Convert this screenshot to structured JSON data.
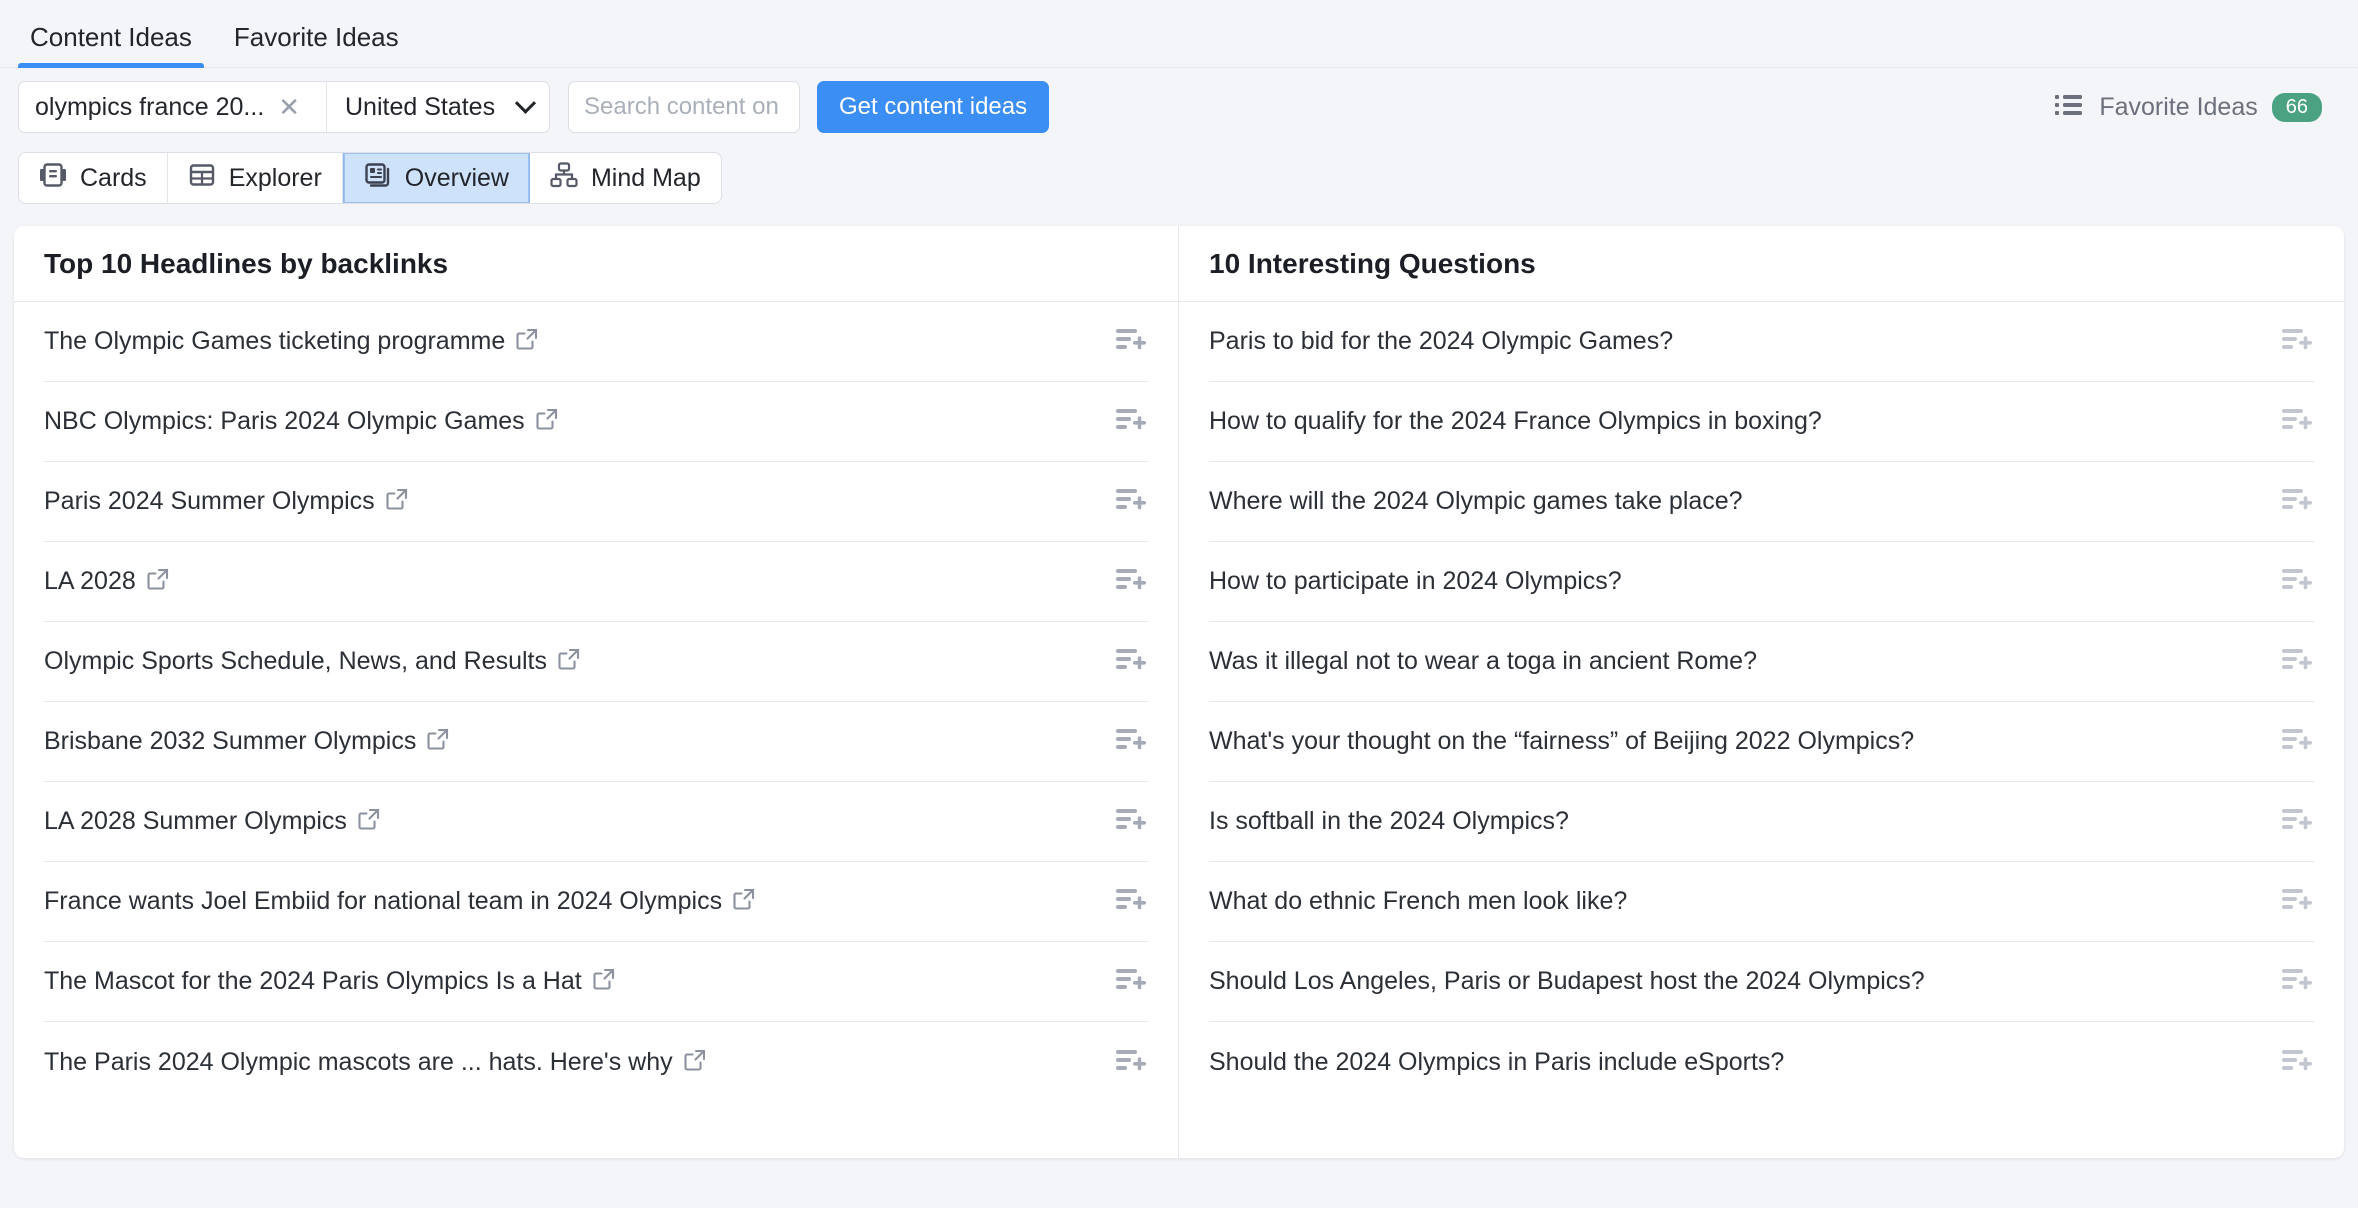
{
  "tabs": [
    {
      "label": "Content Ideas",
      "active": true
    },
    {
      "label": "Favorite Ideas",
      "active": false
    }
  ],
  "search": {
    "keyword_chip": "olympics france 20...",
    "chip_close_icon": "close-icon",
    "country": "United States",
    "country_caret_icon": "chevron-down-icon",
    "domain_placeholder": "Search content on domain",
    "domain_value": "",
    "cta_label": "Get content ideas",
    "cta_color": "#3b8ef3"
  },
  "favorites": {
    "icon": "list-icon",
    "label": "Favorite Ideas",
    "count": "66",
    "badge_color": "#4aa283"
  },
  "views": [
    {
      "label": "Cards",
      "icon": "cards-icon",
      "selected": false
    },
    {
      "label": "Explorer",
      "icon": "table-icon",
      "selected": false
    },
    {
      "label": "Overview",
      "icon": "overview-icon",
      "selected": true
    },
    {
      "label": "Mind Map",
      "icon": "mindmap-icon",
      "selected": false
    }
  ],
  "panels": {
    "headlines": {
      "title": "Top 10 Headlines by backlinks",
      "row_action_icon": "add-to-list-icon",
      "link_icon": "external-link-icon",
      "items": [
        "The Olympic Games ticketing programme",
        "NBC Olympics: Paris 2024 Olympic Games",
        "Paris 2024 Summer Olympics",
        "LA 2028",
        "Olympic Sports Schedule, News, and Results",
        "Brisbane 2032 Summer Olympics",
        "LA 2028 Summer Olympics",
        "France wants Joel Embiid for national team in 2024 Olympics",
        "The Mascot for the 2024 Paris Olympics Is a Hat",
        "The Paris 2024 Olympic mascots are ... hats. Here's why"
      ]
    },
    "questions": {
      "title": "10 Interesting Questions",
      "row_action_icon": "add-to-list-icon",
      "items": [
        "Paris to bid for the 2024 Olympic Games?",
        "How to qualify for the 2024 France Olympics in boxing?",
        "Where will the 2024 Olympic games take place?",
        "How to participate in 2024 Olympics?",
        "Was it illegal not to wear a toga in ancient Rome?",
        "What's your thought on the “fairness” of Beijing 2022 Olympics?",
        "Is softball in the 2024 Olympics?",
        "What do ethnic French men look like?",
        "Should Los Angeles, Paris or Budapest host the 2024 Olympics?",
        "Should the 2024 Olympics in Paris include eSports?"
      ]
    }
  }
}
